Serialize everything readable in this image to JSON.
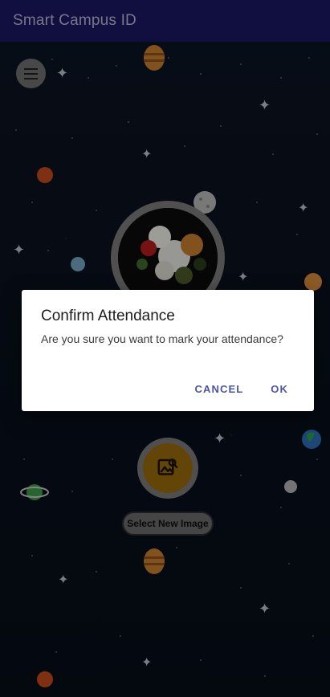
{
  "app": {
    "title": "Smart Campus ID"
  },
  "menu": {
    "icon": "menu-icon"
  },
  "profile": {
    "image_alt": "Profile Photo (flowers)"
  },
  "picker": {
    "icon": "image-search-icon",
    "label": "Select New Image"
  },
  "dialog": {
    "title": "Confirm Attendance",
    "message": "Are you sure you want to mark your attendance?",
    "cancel_label": "CANCEL",
    "ok_label": "OK"
  },
  "colors": {
    "appbar": "#1a1763",
    "accent": "#4b54a6",
    "background": "#0b1220",
    "picker": "#9a6a0d"
  }
}
